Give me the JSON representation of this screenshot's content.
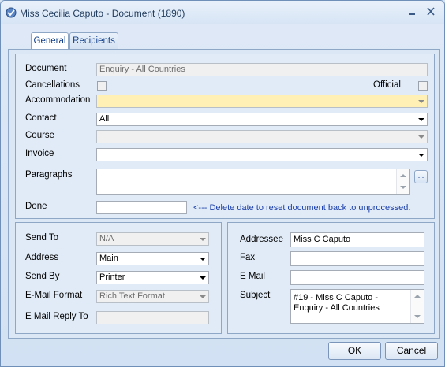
{
  "window": {
    "title": "Miss Cecilia Caputo - Document (1890)",
    "minimize_glyph": "—",
    "close_glyph": "✕"
  },
  "tabs": [
    {
      "label": "General",
      "active": true
    },
    {
      "label": "Recipients",
      "active": false
    }
  ],
  "document_section": {
    "document_label": "Document",
    "document_value": "Enquiry - All Countries",
    "cancellations_label": "Cancellations",
    "official_label": "Official",
    "accommodation_label": "Accommodation",
    "accommodation_value": "",
    "contact_label": "Contact",
    "contact_value": "All",
    "course_label": "Course",
    "course_value": "",
    "invoice_label": "Invoice",
    "invoice_value": "",
    "paragraphs_label": "Paragraphs",
    "paragraphs_value": "",
    "paragraphs_button": "...",
    "done_label": "Done",
    "done_value": "",
    "done_hint": "<--- Delete date to reset document back to unprocessed."
  },
  "send_section": {
    "send_to_label": "Send To",
    "send_to_value": "N/A",
    "address_label": "Address",
    "address_value": "Main",
    "send_by_label": "Send By",
    "send_by_value": "Printer",
    "email_format_label": "E-Mail Format",
    "email_format_value": "Rich Text Format",
    "email_reply_to_label": "E Mail Reply To",
    "email_reply_to_value": ""
  },
  "recipient_section": {
    "addressee_label": "Addressee",
    "addressee_value": "Miss C Caputo",
    "fax_label": "Fax",
    "fax_value": "",
    "email_label": "E Mail",
    "email_value": "",
    "subject_label": "Subject",
    "subject_value": "#19 - Miss C Caputo - Enquiry - All Countries"
  },
  "buttons": {
    "ok_label": "OK",
    "cancel_label": "Cancel"
  },
  "colors": {
    "accent": "#15428b",
    "highlight_field": "#fff1b5",
    "hint_text": "#1b3faa"
  }
}
